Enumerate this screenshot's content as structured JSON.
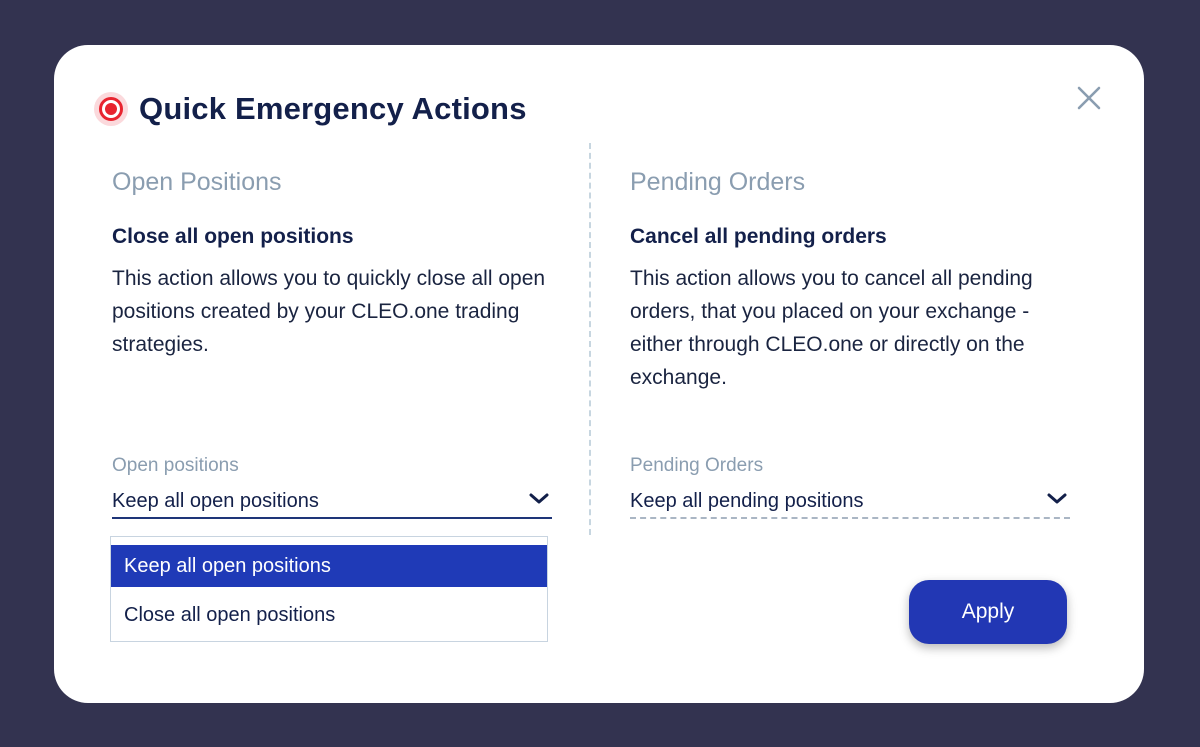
{
  "modal": {
    "title": "Quick Emergency Actions",
    "title_icon": "record-icon",
    "close_icon": "close-icon",
    "apply_label": "Apply"
  },
  "left": {
    "section_title": "Open Positions",
    "action_title": "Close all open positions",
    "description": "This action allows you to quickly close all open positions created by your CLEO.one trading strategies.",
    "select_label": "Open positions",
    "select_value": "Keep all open positions",
    "options": [
      "Keep all open positions",
      "Close all open positions"
    ],
    "selected_option_index": 0,
    "dropdown_open": true
  },
  "right": {
    "section_title": "Pending Orders",
    "action_title": "Cancel all pending orders",
    "description": "This action allows you to cancel all pending orders, that you placed on your exchange - either through CLEO.one or directly on the exchange.",
    "select_label": "Pending Orders",
    "select_value": "Keep all pending positions"
  },
  "colors": {
    "backdrop": "#333350",
    "primary": "#2237b4",
    "title_text": "#13204a",
    "muted_text": "#8a9db0",
    "alert_red": "#e8242f"
  }
}
